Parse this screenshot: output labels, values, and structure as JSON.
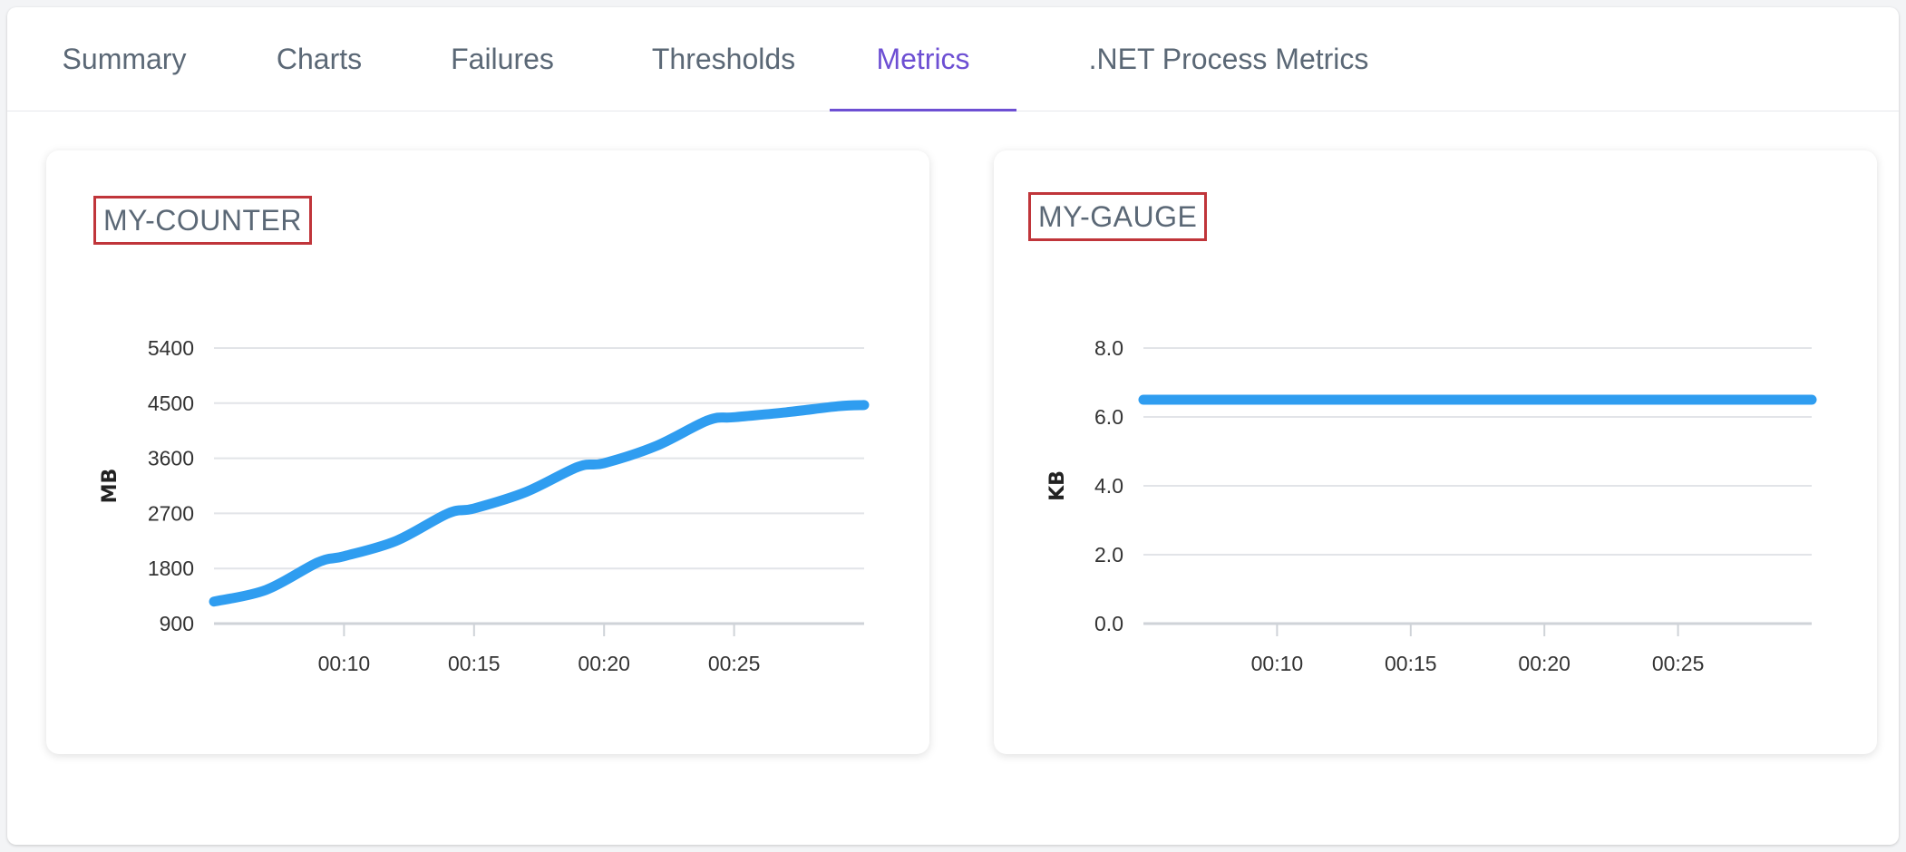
{
  "tabs": [
    {
      "label": "Summary",
      "active": false
    },
    {
      "label": "Charts",
      "active": false
    },
    {
      "label": "Failures",
      "active": false
    },
    {
      "label": "Thresholds",
      "active": false
    },
    {
      "label": "Metrics",
      "active": true
    },
    {
      ".NET Process Metrics": null,
      "label": ".NET Process Metrics",
      "active": false
    }
  ],
  "colors": {
    "accent": "#6d4fd3",
    "line": "#2f9df0",
    "title_highlight": "#c0353a"
  },
  "metrics": [
    {
      "title": "MY-COUNTER"
    },
    {
      "title": "MY-GAUGE"
    }
  ],
  "chart_data": [
    {
      "type": "line",
      "title": "MY-COUNTER",
      "ylabel": "MB",
      "xlabel": "",
      "ylim": [
        900,
        5400
      ],
      "yticks": [
        "5400",
        "4500",
        "3600",
        "2700",
        "1800",
        "900"
      ],
      "xlim": [
        "00:05",
        "00:30"
      ],
      "xticks": [
        "00:10",
        "00:15",
        "00:20",
        "00:25"
      ],
      "grid": true,
      "series": [
        {
          "x": [
            "00:05",
            "00:07",
            "00:09",
            "00:10",
            "00:12",
            "00:14",
            "00:15",
            "00:17",
            "00:19",
            "00:20",
            "00:22",
            "00:24",
            "00:25",
            "00:27",
            "00:29",
            "00:30"
          ],
          "y": [
            1260,
            1450,
            1900,
            2000,
            2250,
            2700,
            2780,
            3050,
            3460,
            3520,
            3800,
            4220,
            4270,
            4350,
            4450,
            4470
          ]
        }
      ]
    },
    {
      "type": "line",
      "title": "MY-GAUGE",
      "ylabel": "KB",
      "xlabel": "",
      "ylim": [
        0,
        8
      ],
      "yticks": [
        "8.0",
        "6.0",
        "4.0",
        "2.0",
        "0.0"
      ],
      "xlim": [
        "00:05",
        "00:30"
      ],
      "xticks": [
        "00:10",
        "00:15",
        "00:20",
        "00:25"
      ],
      "grid": true,
      "series": [
        {
          "x": [
            "00:05",
            "00:10",
            "00:15",
            "00:20",
            "00:25",
            "00:30"
          ],
          "y": [
            6.5,
            6.5,
            6.5,
            6.5,
            6.5,
            6.5
          ]
        }
      ]
    }
  ]
}
